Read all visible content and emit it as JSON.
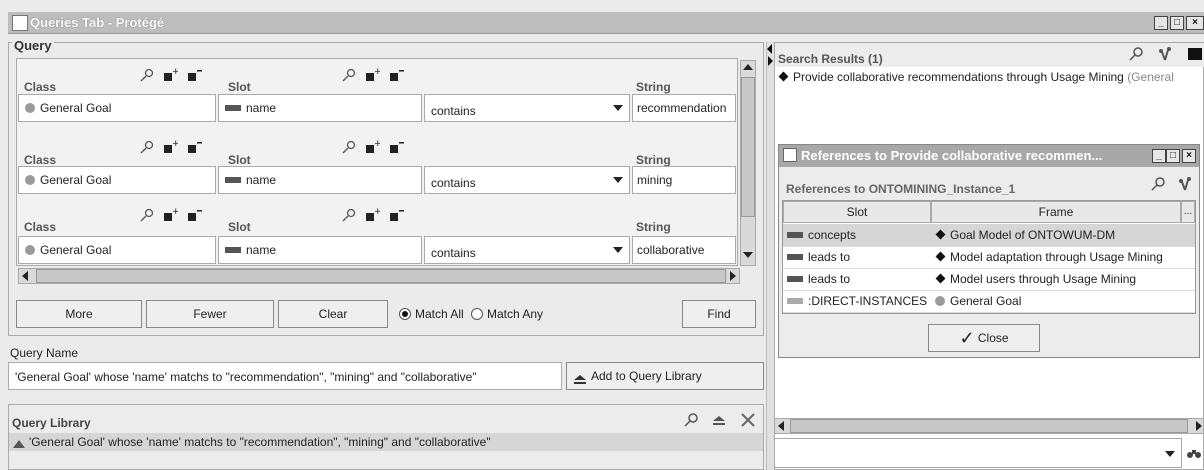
{
  "window": {
    "title": "Queries Tab - Protégé",
    "min": "_",
    "max": "□",
    "close": "×"
  },
  "query": {
    "label": "Query",
    "headers": {
      "class": "Class",
      "slot": "Slot",
      "string": "String"
    },
    "rows": [
      {
        "class": "General Goal",
        "slot": "name",
        "op": "contains",
        "value": "recommendation"
      },
      {
        "class": "General Goal",
        "slot": "name",
        "op": "contains",
        "value": "mining"
      },
      {
        "class": "General Goal",
        "slot": "name",
        "op": "contains",
        "value": "collaborative"
      }
    ],
    "buttons": {
      "more": "More",
      "fewer": "Fewer",
      "clear": "Clear",
      "find": "Find"
    },
    "match_all": "Match All",
    "match_any": "Match Any",
    "match_selected": "all"
  },
  "query_name": {
    "label": "Query Name",
    "value": "'General Goal' whose 'name' matchs to \"recommendation\", \"mining\" and \"collaborative\"",
    "add_button": "Add to Query Library"
  },
  "query_library": {
    "label": "Query Library",
    "items": [
      "'General Goal' whose 'name' matchs to \"recommendation\", \"mining\" and \"collaborative\""
    ]
  },
  "search_results": {
    "label": "Search Results (1)",
    "item": "Provide collaborative recommendations through Usage Mining",
    "item_suffix": "(General"
  },
  "references": {
    "title": "References to Provide collaborative recommen...",
    "subtitle": "References to ONTOMINING_Instance_1",
    "columns": {
      "slot": "Slot",
      "frame": "Frame",
      "more": "..."
    },
    "rows": [
      {
        "slot": "concepts",
        "frame": "Goal Model of ONTOWUM-DM",
        "frame_icon": "diamond",
        "slot_icon": "dark"
      },
      {
        "slot": "leads to",
        "frame": "Model adaptation through Usage Mining",
        "frame_icon": "diamond",
        "slot_icon": "dark"
      },
      {
        "slot": "leads to",
        "frame": "Model users through Usage Mining",
        "frame_icon": "diamond",
        "slot_icon": "dark"
      },
      {
        "slot": ":DIRECT-INSTANCES",
        "frame": "General Goal",
        "frame_icon": "circle",
        "slot_icon": "light"
      }
    ],
    "close_button": "Close"
  },
  "colors": {
    "titlebar": "#bdbdbd",
    "panel": "#f2f2f2",
    "selected_row": "#d6d6d6"
  }
}
